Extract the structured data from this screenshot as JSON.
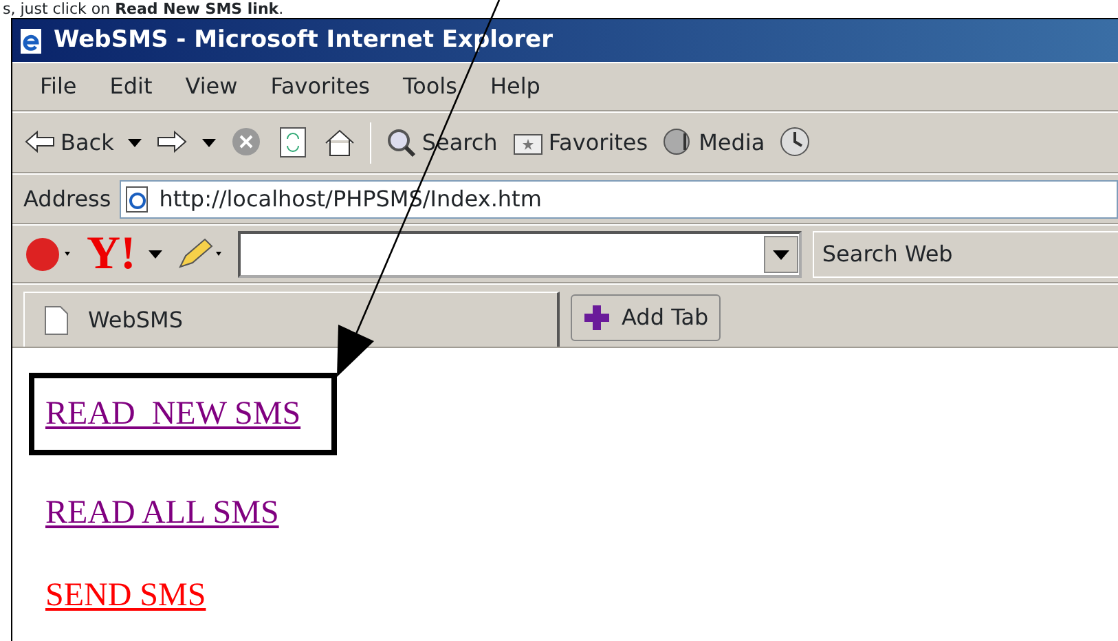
{
  "caption": "s, just click on **Read New SMS link**.",
  "window": {
    "title": "WebSMS - Microsoft Internet Explorer"
  },
  "menu": [
    "File",
    "Edit",
    "View",
    "Favorites",
    "Tools",
    "Help"
  ],
  "toolbar": [
    {
      "kind": "back",
      "label": "Back"
    },
    {
      "kind": "forward"
    },
    {
      "kind": "stop"
    },
    {
      "kind": "refresh"
    },
    {
      "kind": "home"
    },
    {
      "kind": "search",
      "label": "Search"
    },
    {
      "kind": "favorites",
      "label": "Favorites"
    },
    {
      "kind": "media",
      "label": "Media"
    },
    {
      "kind": "history"
    }
  ],
  "address": {
    "label": "Address",
    "value": "http://localhost/PHPSMS/Index.htm"
  },
  "yahoo_toolbar": {
    "logo": "Y!",
    "search_button": "Search Web"
  },
  "tabs": [
    {
      "label": "WebSMS",
      "selected": true
    }
  ],
  "add_tab": "Add Tab",
  "links": [
    {
      "label": "READ  NEW SMS",
      "color": "#800080",
      "highlighted": true
    },
    {
      "label": "READ ALL SMS",
      "color": "#800080",
      "highlighted": false
    },
    {
      "label": "SEND SMS",
      "color": "#ff0000",
      "highlighted": false
    }
  ]
}
